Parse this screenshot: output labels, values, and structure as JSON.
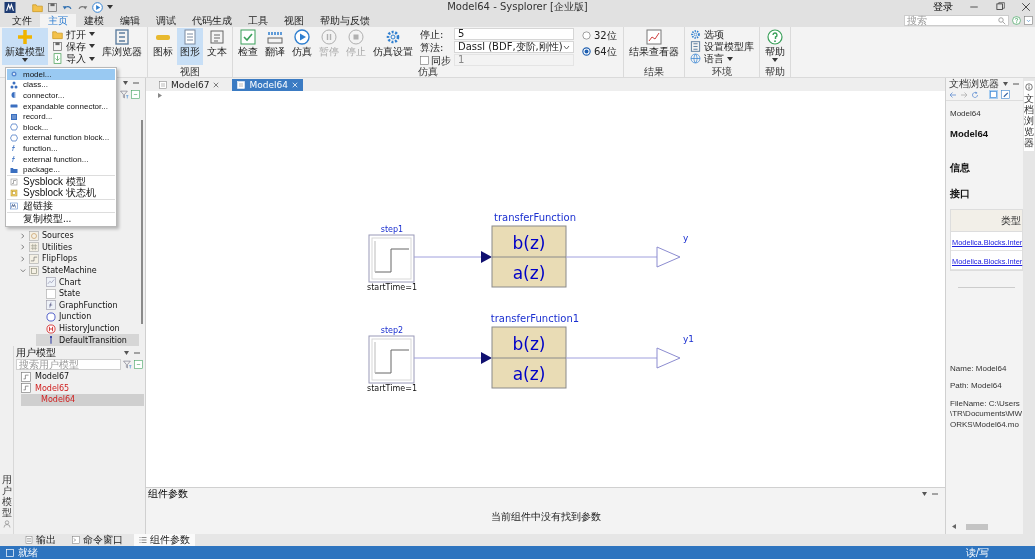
{
  "window": {
    "title": "Model64 - Sysplorer [企业版]",
    "login": "登录"
  },
  "menu_tabs": [
    {
      "label": "文件",
      "selected": false
    },
    {
      "label": "主页",
      "selected": true
    },
    {
      "label": "建模",
      "selected": false
    },
    {
      "label": "编辑",
      "selected": false
    },
    {
      "label": "调试",
      "selected": false
    },
    {
      "label": "代码生成",
      "selected": false
    },
    {
      "label": "工具",
      "selected": false
    },
    {
      "label": "视图",
      "selected": false
    },
    {
      "label": "帮助与反馈",
      "selected": false
    }
  ],
  "search": {
    "placeholder": "搜索"
  },
  "ribbon": {
    "groups": [
      {
        "items": [
          {
            "kind": "large",
            "label": "新建模型",
            "caret": true,
            "selected": true,
            "disabled": false
          },
          {
            "kind": "stack",
            "items": [
              {
                "label": "打开",
                "caret": true
              },
              {
                "label": "保存",
                "caret": true
              },
              {
                "label": "导入",
                "caret": true
              }
            ]
          },
          {
            "kind": "large",
            "label": "库浏览器",
            "caret": false,
            "selected": false,
            "disabled": false
          }
        ]
      },
      {
        "label": "视图",
        "items": [
          {
            "kind": "large",
            "label": "图标",
            "caret": false,
            "selected": false,
            "disabled": false
          },
          {
            "kind": "large",
            "label": "图形",
            "caret": false,
            "selected": true,
            "disabled": false
          },
          {
            "kind": "large",
            "label": "文本",
            "caret": false,
            "selected": false,
            "disabled": false
          }
        ]
      },
      {
        "label": "仿真",
        "items": [
          {
            "kind": "large",
            "label": "检查",
            "caret": false,
            "selected": false,
            "disabled": false
          },
          {
            "kind": "large",
            "label": "翻译",
            "caret": false,
            "selected": false,
            "disabled": false
          },
          {
            "kind": "large",
            "label": "仿真",
            "caret": false,
            "selected": false,
            "disabled": false
          },
          {
            "kind": "large",
            "label": "暂停",
            "caret": false,
            "selected": false,
            "disabled": true
          },
          {
            "kind": "large",
            "label": "停止",
            "caret": false,
            "selected": false,
            "disabled": true
          },
          {
            "kind": "large",
            "label": "仿真设置",
            "caret": false,
            "selected": false,
            "disabled": false
          },
          {
            "kind": "form",
            "stop_label": "停止:",
            "stop_value": "5",
            "algo_label": "算法:",
            "algo_value": "Dassl (BDF,变阶,刚性)",
            "sync": {
              "label": "同步",
              "checked": false,
              "value": "1"
            }
          },
          {
            "kind": "radios",
            "options": [
              {
                "label": "32位",
                "selected": false
              },
              {
                "label": "64位",
                "selected": true
              }
            ]
          }
        ]
      },
      {
        "label": "结果",
        "items": [
          {
            "kind": "large",
            "label": "结果查看器",
            "caret": false,
            "selected": false,
            "disabled": false
          }
        ]
      },
      {
        "label": "环境",
        "items": [
          {
            "kind": "stack",
            "items": [
              {
                "label": "选项",
                "caret": false
              },
              {
                "label": "设置模型库",
                "caret": false
              },
              {
                "label": "语言",
                "caret": true
              }
            ]
          }
        ]
      },
      {
        "label": "帮助",
        "items": [
          {
            "kind": "large",
            "label": "帮助",
            "caret": true,
            "selected": false,
            "disabled": false
          }
        ]
      }
    ]
  },
  "new_model_menu": {
    "sections": [
      {
        "items": [
          {
            "label": "model...",
            "selected": true
          },
          {
            "label": "class...",
            "selected": false
          },
          {
            "label": "connector...",
            "selected": false
          },
          {
            "label": "expandable connector...",
            "selected": false
          },
          {
            "label": "record...",
            "selected": false
          },
          {
            "label": "block...",
            "selected": false
          },
          {
            "label": "external function block...",
            "selected": false
          },
          {
            "label": "function...",
            "selected": false
          },
          {
            "label": "external function...",
            "selected": false
          },
          {
            "label": "package...",
            "selected": false
          }
        ]
      },
      {
        "items": [
          {
            "label": "Sysblock 模型",
            "selected": false
          },
          {
            "label": "Sysblock 状态机",
            "selected": false
          }
        ]
      },
      {
        "items": [
          {
            "label": "超链接",
            "selected": false
          }
        ]
      },
      {
        "items": [
          {
            "label": "复制模型...",
            "selected": false
          }
        ]
      }
    ]
  },
  "model_browser": {
    "tree": [
      {
        "label": "Sources",
        "expanded": false,
        "selected": false
      },
      {
        "label": "Utilities",
        "expanded": false,
        "selected": false
      },
      {
        "label": "FlipFlops",
        "expanded": false,
        "selected": false
      },
      {
        "label": "StateMachine",
        "expanded": true,
        "selected": false,
        "children": [
          {
            "label": "Chart",
            "selected": false
          },
          {
            "label": "State",
            "selected": false
          },
          {
            "label": "GraphFunction",
            "selected": false
          },
          {
            "label": "Junction",
            "selected": false
          },
          {
            "label": "HistoryJunction",
            "selected": false
          },
          {
            "label": "DefaultTransition",
            "selected": true
          }
        ]
      }
    ]
  },
  "user_models": {
    "title": "用户模型",
    "search": {
      "placeholder": "搜索用户模型"
    },
    "items": [
      {
        "label": "Model67",
        "modified": false,
        "selected": false
      },
      {
        "label": "Model65",
        "modified": true,
        "selected": false
      },
      {
        "label": "Model64",
        "modified": true,
        "selected": true
      }
    ]
  },
  "left_strip": {
    "label": "用户模型"
  },
  "doc_tabs": [
    {
      "label": "Model67",
      "selected": false
    },
    {
      "label": "Model64",
      "selected": true
    }
  ],
  "diagram": {
    "rows": [
      {
        "source": {
          "name": "step1",
          "param": "startTime=1"
        },
        "transfer": {
          "name": "transferFunction",
          "numerator": "b(z)",
          "denominator": "a(z)"
        },
        "output": {
          "name": "y"
        }
      },
      {
        "source": {
          "name": "step2",
          "param": "startTime=1"
        },
        "transfer": {
          "name": "transferFunction1",
          "numerator": "b(z)",
          "denominator": "a(z)"
        },
        "output": {
          "name": "y1"
        }
      }
    ]
  },
  "component_params": {
    "title": "组件参数",
    "message": "当前组件中没有找到参数"
  },
  "doc_browser": {
    "title": "文档浏览器",
    "breadcrumb": "Model64",
    "heading": "Model64",
    "info_heading": "信息",
    "interface_heading": "接口",
    "table": {
      "columns": [
        "类型"
      ],
      "rows": [
        "Modelica.Blocks.Inter",
        "Modelica.Blocks.Inter"
      ]
    },
    "details": [
      "Name: Model64",
      "Path: Model64",
      "FileName: C:\\Users\\TR\\Documents\\MWORKS\\Model64.mo"
    ]
  },
  "side_tab": {
    "label": "文档浏览器"
  },
  "bottom_tabs": [
    {
      "label": "输出",
      "selected": false
    },
    {
      "label": "命令窗口",
      "selected": false
    },
    {
      "label": "组件参数",
      "selected": true
    }
  ],
  "status_bar": {
    "left": "就绪",
    "right": "读/写"
  }
}
